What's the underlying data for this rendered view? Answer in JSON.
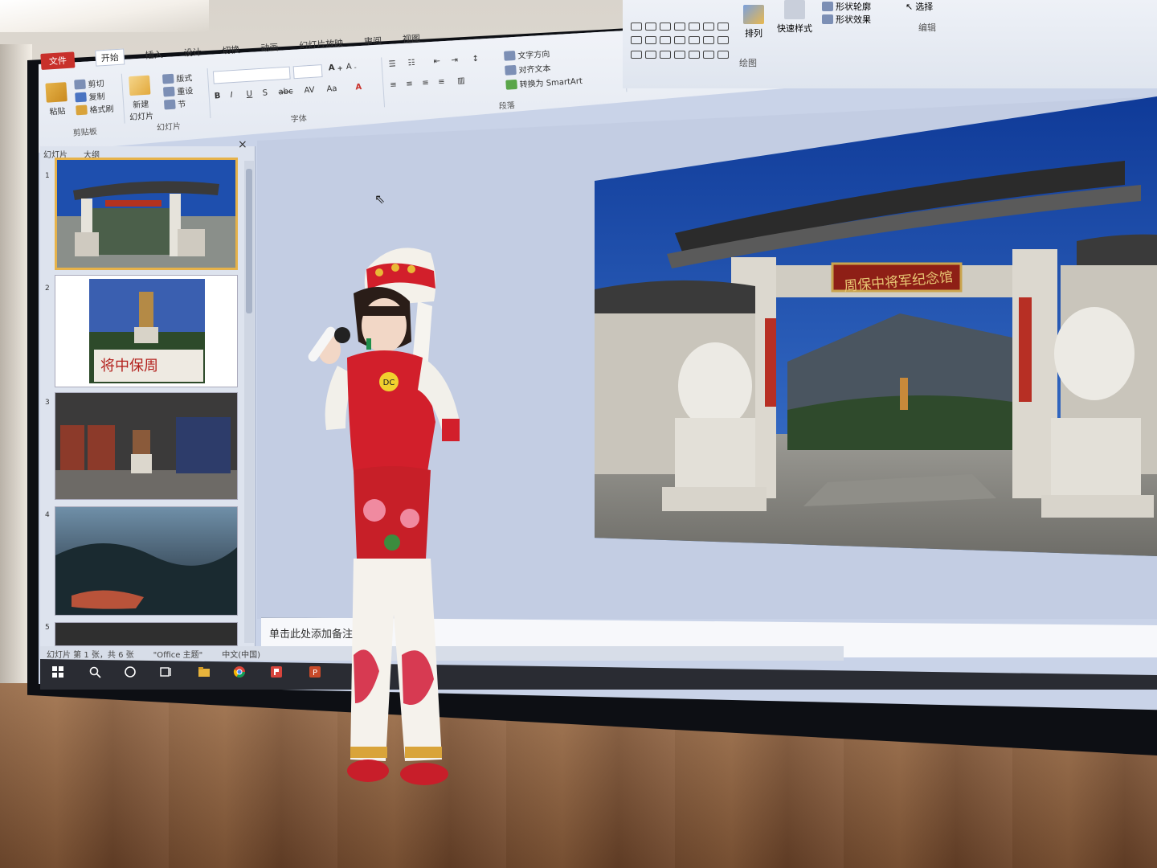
{
  "ribbon": {
    "tabs": [
      "文件",
      "开始",
      "插入",
      "设计",
      "切换",
      "动画",
      "幻灯片放映",
      "审阅",
      "视图"
    ],
    "clipboard": {
      "paste": "粘贴",
      "cut": "剪切",
      "copy": "复制",
      "format_painter": "格式刷",
      "label": "剪贴板"
    },
    "slides": {
      "new_slide": "新建\n幻灯片",
      "layout": "版式",
      "reset": "重设",
      "section": "节",
      "label": "幻灯片"
    },
    "font": {
      "label": "字体"
    },
    "paragraph": {
      "text_direction": "文字方向",
      "align_text": "对齐文本",
      "smartart": "转换为 SmartArt",
      "label": "段落"
    },
    "drawing": {
      "arrange": "排列",
      "quick_styles": "快速样式",
      "shape_outline": "形状轮廓",
      "shape_effects": "形状效果",
      "label": "绘图"
    },
    "editing": {
      "select": "选择",
      "label": "编辑"
    }
  },
  "panel": {
    "tab_slides": "幻灯片",
    "tab_outline": "大纲",
    "close": "×"
  },
  "thumbs": [
    "1",
    "2",
    "3",
    "4",
    "5"
  ],
  "thumb2_caption": "将中保周",
  "slide_banner": "周保中将军纪念馆",
  "notes_placeholder": "单击此处添加备注",
  "status": {
    "slide_info": "幻灯片 第 1 张，共 6 张",
    "theme": "\"Office 主题\"",
    "language": "中文(中国)"
  },
  "contestant_tag": "DC",
  "colors": {
    "ppt_accent": "#c8312b",
    "costume_red": "#d21f2b",
    "sky": "#1e4fae"
  }
}
